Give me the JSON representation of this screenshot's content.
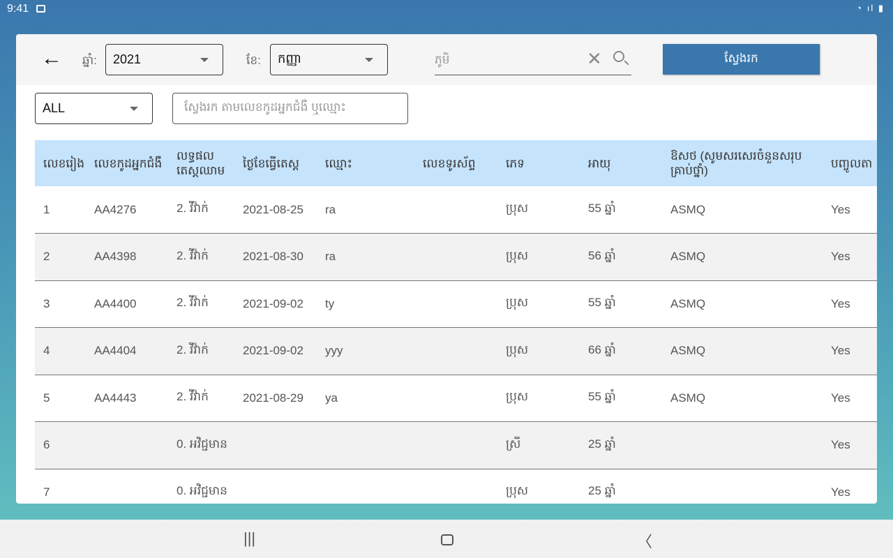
{
  "status": {
    "time": "9:41",
    "icons": "wifi signal battery"
  },
  "toolbar": {
    "year_label": "ឆ្នាំ:",
    "year": "2021",
    "month_label": "ខែ:",
    "month": "កញ្ញា",
    "search_placeholder": "ភូមិ",
    "search_button": "ស្វែងរក"
  },
  "filter": {
    "type": "ALL",
    "search_placeholder": "ស្វែងរក តាមលេខកូដអ្នកជំងឺ ឬឈ្មោះ"
  },
  "table": {
    "headers": [
      "លេខរៀង",
      "លេខកូដអ្នកជំងឺ",
      "លទ្ធផល តេស្តឈាម",
      "ថ្ងៃខែធ្វើតេស្ត",
      "ឈ្មោះ",
      "លេខទូរស័ព្ទ",
      "ភេទ",
      "អាយុ",
      "ឱសថ (សូមសរសេរចំនួនសរុប គ្រាប់ថ្នាំ)",
      "បញ្ចូលតា"
    ],
    "rows": [
      [
        "1",
        "AA4276",
        "2. វីវ៉ាក់",
        "2021-08-25",
        "ra",
        "",
        "ប្រុស",
        "55 ឆ្នាំ",
        "ASMQ",
        "Yes"
      ],
      [
        "2",
        "AA4398",
        "2. វីវ៉ាក់",
        "2021-08-30",
        "ra",
        "",
        "ប្រុស",
        "56 ឆ្នាំ",
        "ASMQ",
        "Yes"
      ],
      [
        "3",
        "AA4400",
        "2. វីវ៉ាក់",
        "2021-09-02",
        "ty",
        "",
        "ប្រុស",
        "55 ឆ្នាំ",
        "ASMQ",
        "Yes"
      ],
      [
        "4",
        "AA4404",
        "2. វីវ៉ាក់",
        "2021-09-02",
        "yyy",
        "",
        "ប្រុស",
        "66 ឆ្នាំ",
        "ASMQ",
        "Yes"
      ],
      [
        "5",
        "AA4443",
        "2. វីវ៉ាក់",
        "2021-08-29",
        "ya",
        "",
        "ប្រុស",
        "55 ឆ្នាំ",
        "ASMQ",
        "Yes"
      ],
      [
        "6",
        "",
        "0. អវិជ្ជមាន",
        "",
        "",
        "",
        "ស្រី",
        "25 ឆ្នាំ",
        "",
        "Yes"
      ],
      [
        "7",
        "",
        "0. អវិជ្ជមាន",
        "",
        "",
        "",
        "ប្រុស",
        "25 ឆ្នាំ",
        "",
        "Yes"
      ]
    ]
  },
  "colors": {
    "accent": "#3a77ad",
    "header_bg": "#c5e3fb"
  }
}
